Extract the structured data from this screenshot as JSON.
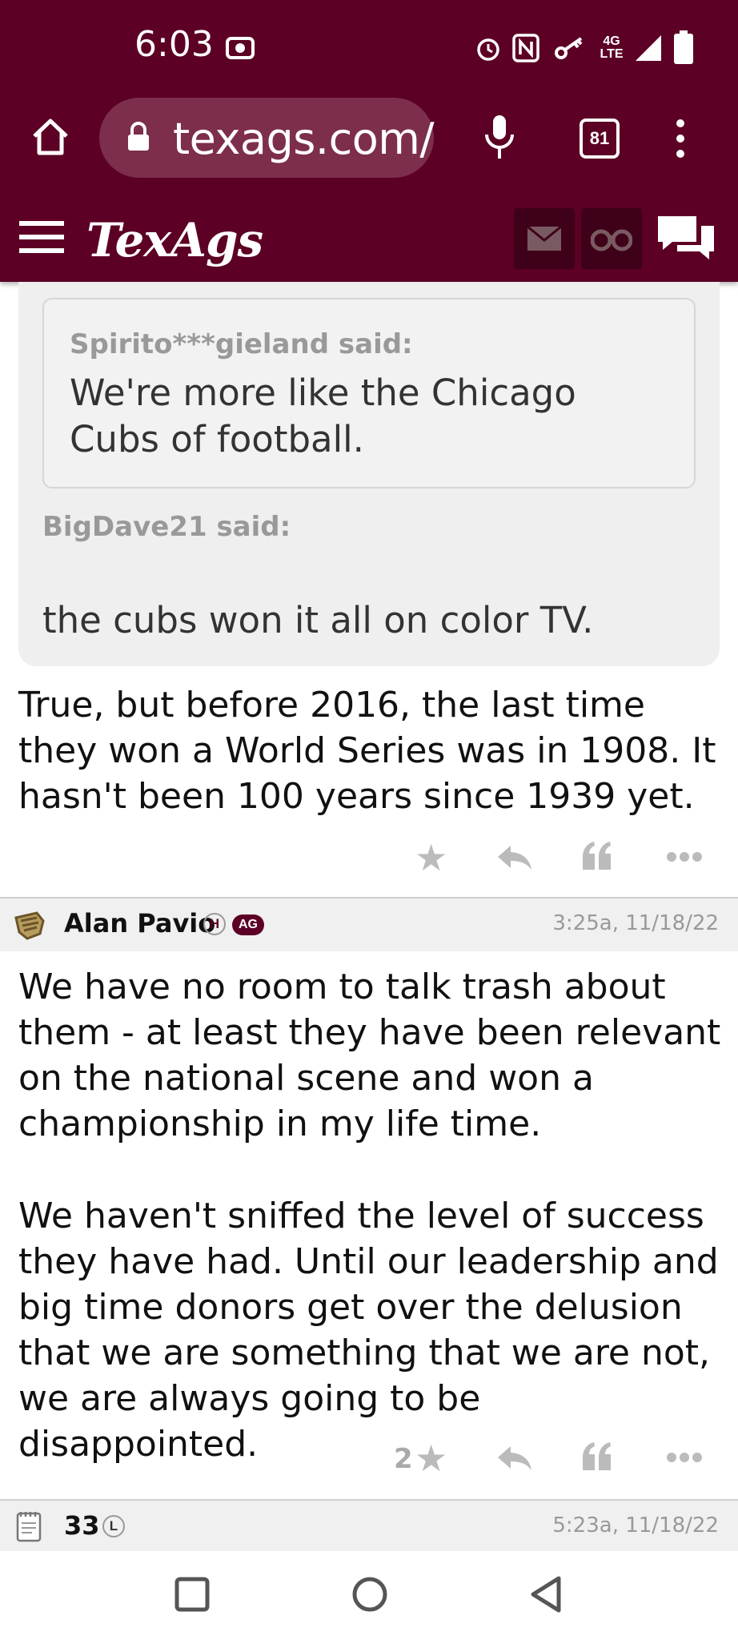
{
  "status": {
    "time": "6:03",
    "network": "4G LTE"
  },
  "browser": {
    "url": "texags.com/",
    "tab_count": "81"
  },
  "site": {
    "logo": "TexAgs"
  },
  "quote": {
    "inner_author": "Spirito***gieland said:",
    "inner_text": "We're more like the Chicago Cubs of football.",
    "outer_author": "BigDave21 said:",
    "outer_text": "the cubs won it all on color TV."
  },
  "post1": {
    "body": "True, but before 2016, the last time they won a World Series was in 1908. It hasn't been 100 years since 1939 yet."
  },
  "post2": {
    "author": "Alan Pavio",
    "badge_h": "H",
    "badge_ag": "AG",
    "timestamp": "3:25a, 11/18/22",
    "body_p1": "We have no room to talk trash about them - at least they have been relevant on the national scene and won a championship in my life time.",
    "body_p2": "We haven't sniffed the level of success they have had. Until our leadership and big time donors get over the delusion that we are something that we are not, we are always going to be disappointed.",
    "star_count": "2"
  },
  "post3": {
    "author": "33",
    "badge_l": "L",
    "timestamp": "5:23a, 11/18/22"
  }
}
